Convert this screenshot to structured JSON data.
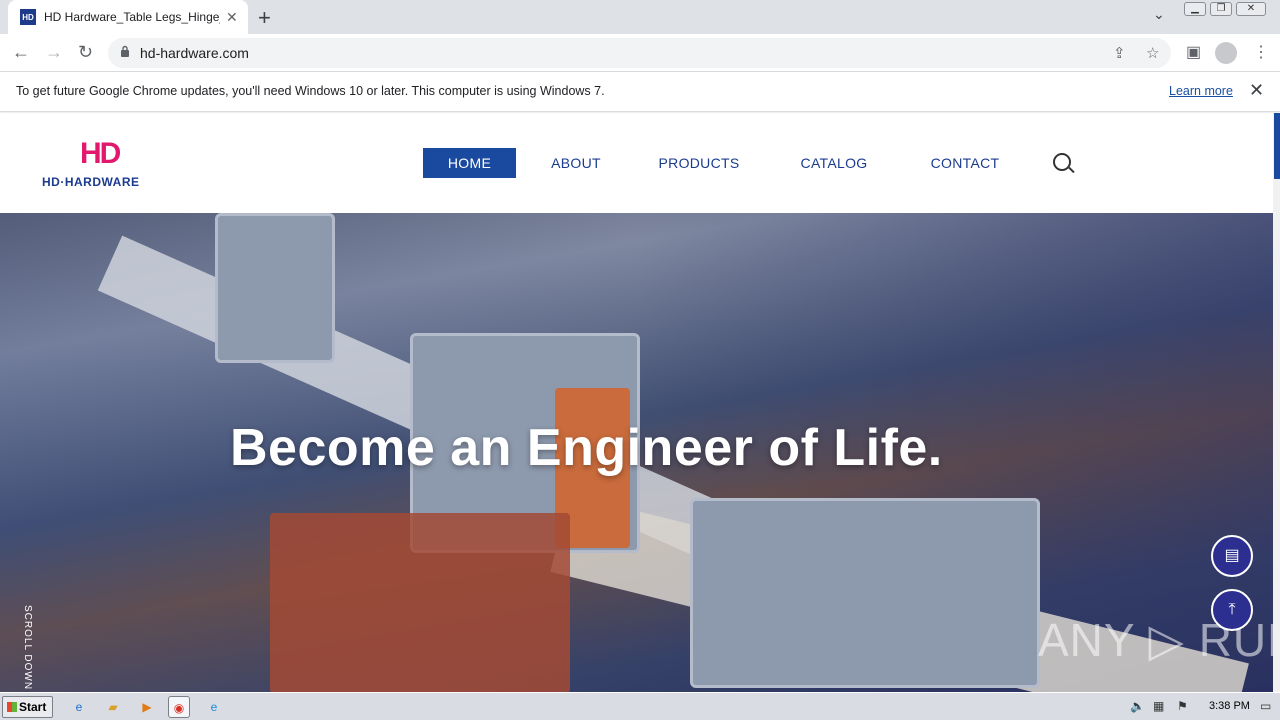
{
  "browser": {
    "tab_title": "HD Hardware_Table Legs_Hinge_Metal",
    "favicon_text": "HD",
    "url": "hd-hardware.com"
  },
  "infobar": {
    "message": "To get future Google Chrome updates, you'll need Windows 10 or later. This computer is using Windows 7.",
    "learn_more": "Learn more"
  },
  "site": {
    "logo_mark": "HD",
    "logo_text": "HD·HARDWARE",
    "nav": [
      {
        "label": "HOME",
        "active": true
      },
      {
        "label": "ABOUT",
        "active": false
      },
      {
        "label": "PRODUCTS",
        "active": false
      },
      {
        "label": "CATALOG",
        "active": false
      },
      {
        "label": "CONTACT",
        "active": false
      }
    ],
    "search_icon": "search-icon"
  },
  "hero": {
    "title": "Become an Engineer of Life.",
    "scroll_label": "SCROLL DOWN"
  },
  "watermark": "ANY ▷ RUN",
  "taskbar": {
    "start_label": "Start",
    "clock": "3:38 PM"
  },
  "colors": {
    "brand_blue": "#1b3b8f",
    "nav_active": "#1a4aa0",
    "brand_pink": "#e2186f",
    "fab_bg": "#2c2f8f"
  }
}
